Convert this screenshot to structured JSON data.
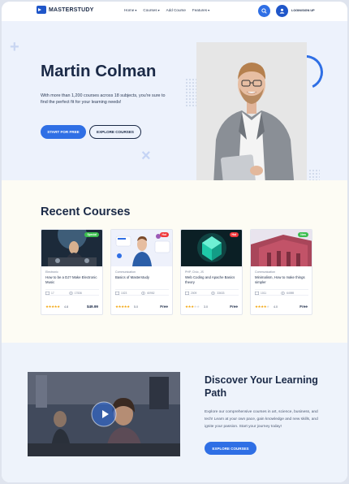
{
  "header": {
    "logo_text": "MASTERSTUDY",
    "nav": [
      {
        "label": "Home",
        "dropdown": true
      },
      {
        "label": "Courses",
        "dropdown": true
      },
      {
        "label": "Add Course",
        "dropdown": false
      },
      {
        "label": "Features",
        "dropdown": true
      }
    ],
    "login_label": "LOGIN/SIGN UP",
    "icons": {
      "search": "search-icon",
      "user": "user-icon"
    }
  },
  "hero": {
    "title": "Martin Colman",
    "text": "With more than 1,200 courses across 18 subjects, you're sure to find the perfect fit for your learning needs!",
    "primary_button": "START FOR FREE",
    "secondary_button": "EXPLORE COURSES"
  },
  "courses": {
    "title": "Recent Courses",
    "items": [
      {
        "badge": "Special",
        "badge_color": "#3cbf4f",
        "category": "Electronic",
        "name": "How to be a DJ? Make Electronic Music",
        "lectures": "17",
        "views": "17536",
        "stars": 4.5,
        "rating": "4.8",
        "price": "$49.99"
      },
      {
        "badge": "Hot",
        "badge_color": "#f0373a",
        "category": "Communication",
        "name": "Basics of Masterstudy",
        "lectures": "1023",
        "views": "60952",
        "stars": 5,
        "rating": "5.0",
        "price": "Free"
      },
      {
        "badge": "Hot",
        "badge_color": "#f0373a",
        "category": "PHP, Civic, JS",
        "name": "Web Coding and Apache Basics theory",
        "lectures": "2009",
        "views": "33633",
        "stars": 3,
        "rating": "3.0",
        "price": "Free"
      },
      {
        "badge": "New",
        "badge_color": "#3cbf4f",
        "category": "Communication",
        "name": "Minimalism, How to make things simpler",
        "lectures": "1011",
        "views": "64989",
        "stars": 4,
        "rating": "4.0",
        "price": "Free"
      }
    ]
  },
  "discover": {
    "title": "Discover Your Learning Path",
    "text": "Explore our comprehensive courses in art, science, business, and tech! Learn at your own pace, gain knowledge and new skills, and ignite your passion. Start your journey today!",
    "button": "EXPLORE COURSES",
    "play_icon": "play-icon"
  },
  "colors": {
    "accent": "#2f6fe5",
    "brand": "#1f56c9",
    "text": "#1b2a47"
  }
}
